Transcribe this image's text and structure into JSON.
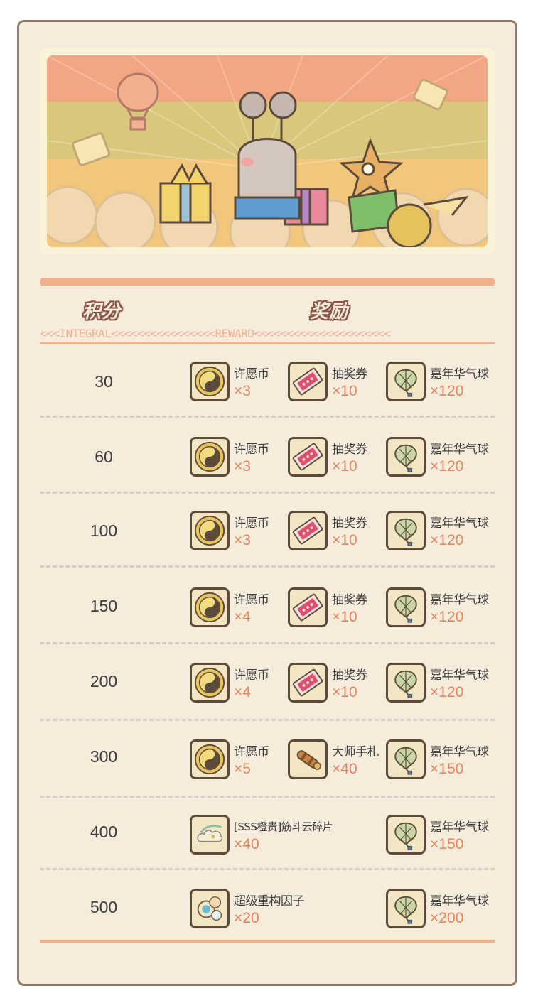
{
  "headers": {
    "integral_label": "积分",
    "reward_label": "奖励",
    "subband_left": "<<<INTEGRAL<<<<<<<<<<<<<<<<",
    "subband_right": "REWARD<<<<<<<<<<<<<<<<<<<<<"
  },
  "items": {
    "wish_coin": {
      "name": "许愿币",
      "icon": "wish-coin-icon"
    },
    "lottery_ticket": {
      "name": "抽奖券",
      "icon": "lottery-ticket-icon"
    },
    "carnival_balloon": {
      "name": "嘉年华气球",
      "icon": "carnival-balloon-icon"
    },
    "master_notebook": {
      "name": "大师手札",
      "icon": "master-notebook-icon"
    },
    "cloud_fragment": {
      "name": "[SSS橙贵]筋斗云碎片",
      "icon": "cloud-fragment-icon"
    },
    "factor": {
      "name": "超级重构因子",
      "icon": "reconstruction-factor-icon"
    }
  },
  "rows": [
    {
      "score": "30",
      "rewards": [
        {
          "name": "许愿币",
          "qty": "×3"
        },
        {
          "name": "抽奖券",
          "qty": "×10"
        },
        {
          "name": "嘉年华气球",
          "qty": "×120"
        }
      ]
    },
    {
      "score": "60",
      "rewards": [
        {
          "name": "许愿币",
          "qty": "×3"
        },
        {
          "name": "抽奖券",
          "qty": "×10"
        },
        {
          "name": "嘉年华气球",
          "qty": "×120"
        }
      ]
    },
    {
      "score": "100",
      "rewards": [
        {
          "name": "许愿币",
          "qty": "×3"
        },
        {
          "name": "抽奖券",
          "qty": "×10"
        },
        {
          "name": "嘉年华气球",
          "qty": "×120"
        }
      ]
    },
    {
      "score": "150",
      "rewards": [
        {
          "name": "许愿币",
          "qty": "×4"
        },
        {
          "name": "抽奖券",
          "qty": "×10"
        },
        {
          "name": "嘉年华气球",
          "qty": "×120"
        }
      ]
    },
    {
      "score": "200",
      "rewards": [
        {
          "name": "许愿币",
          "qty": "×4"
        },
        {
          "name": "抽奖券",
          "qty": "×10"
        },
        {
          "name": "嘉年华气球",
          "qty": "×120"
        }
      ]
    },
    {
      "score": "300",
      "rewards": [
        {
          "name": "许愿币",
          "qty": "×5"
        },
        {
          "name": "大师手札",
          "qty": "×40"
        },
        {
          "name": "嘉年华气球",
          "qty": "×150"
        }
      ]
    },
    {
      "score": "400",
      "rewards": [
        {
          "name": "[SSS橙贵]筋斗云碎片",
          "qty": "×40"
        },
        {
          "name": "嘉年华气球",
          "qty": "×150"
        }
      ]
    },
    {
      "score": "500",
      "rewards": [
        {
          "name": "超级重构因子",
          "qty": "×20"
        },
        {
          "name": "嘉年华气球",
          "qty": "×200"
        }
      ]
    }
  ],
  "colors": {
    "panel_bg": "#f6ecdc",
    "accent_orange": "#e5855e",
    "band_stripe": "#eeb18c",
    "text_dark": "#3c3c3c"
  }
}
